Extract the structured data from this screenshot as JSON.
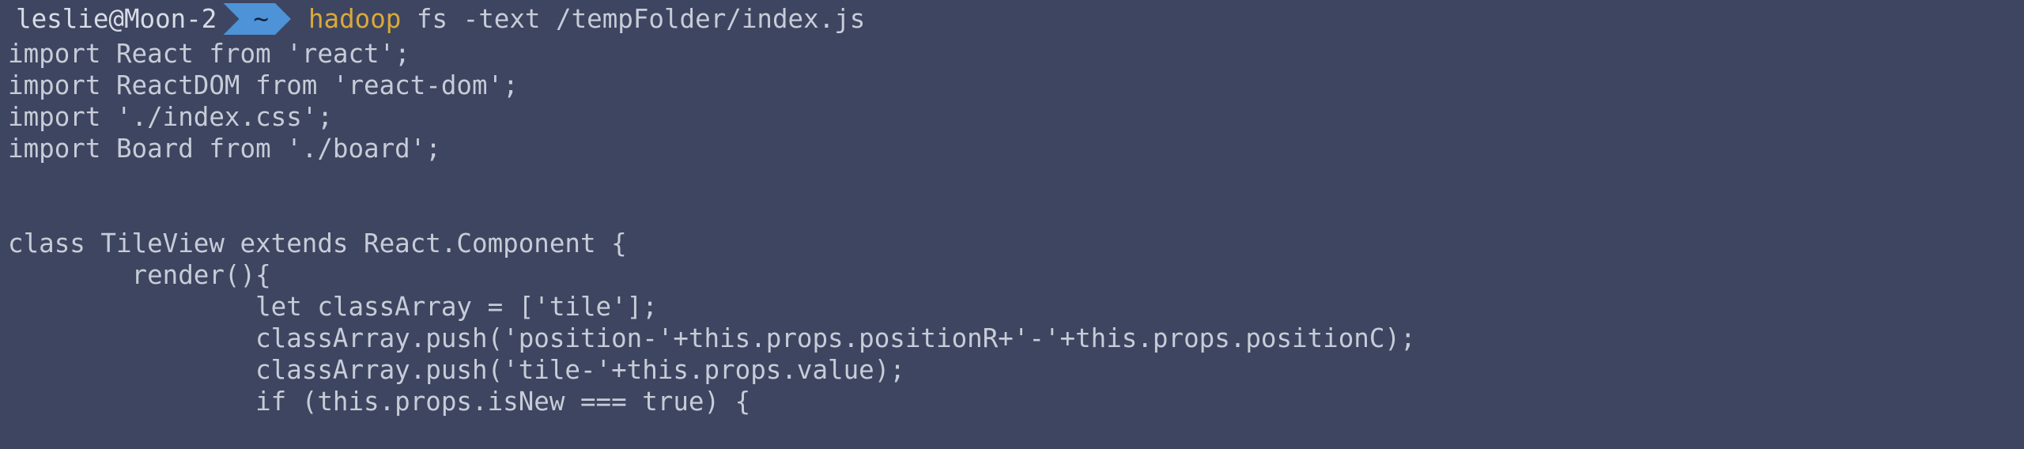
{
  "prompt": {
    "user_host": "leslie@Moon-2",
    "path": "~",
    "command": "hadoop",
    "arguments": " fs -text /tempFolder/index.js"
  },
  "output": {
    "lines_top": [
      "import React from 'react';",
      "import ReactDOM from 'react-dom';",
      "import './index.css';",
      "import Board from './board';"
    ],
    "lines_bottom": [
      "class TileView extends React.Component {",
      "        render(){",
      "                let classArray = ['tile'];",
      "                classArray.push('position-'+this.props.positionR+'-'+this.props.positionC);",
      "                classArray.push('tile-'+this.props.value);",
      "                if (this.props.isNew === true) {"
    ]
  }
}
